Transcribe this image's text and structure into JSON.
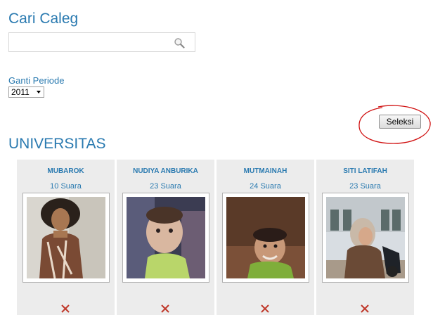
{
  "header": {
    "title": "Cari Caleg"
  },
  "search": {
    "value": "",
    "placeholder": ""
  },
  "period": {
    "label": "Ganti Periode",
    "selected": "2011"
  },
  "toolbar": {
    "seleksi_label": "Seleksi"
  },
  "section": {
    "heading": "UNIVERSITAS"
  },
  "candidates": [
    {
      "name": "MUBAROK",
      "votes": "10 Suara"
    },
    {
      "name": "NUDIYA ANBURIKA",
      "votes": "23 Suara"
    },
    {
      "name": "MUTMAINAH",
      "votes": "24 Suara"
    },
    {
      "name": "SITI LATIFAH",
      "votes": "23 Suara"
    }
  ],
  "colors": {
    "link_blue": "#2a7ab0",
    "card_bg": "#ececec",
    "remove_red": "#c0392b",
    "annotation_red": "#d01010"
  },
  "icons": {
    "search": "search-icon",
    "remove": "close-icon",
    "dropdown": "chevron-down-icon"
  }
}
